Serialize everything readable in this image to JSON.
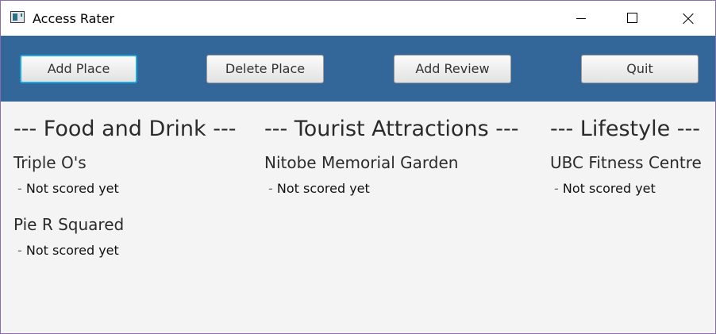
{
  "window": {
    "title": "Access Rater",
    "controls": {
      "minimize_icon": "minimize-icon",
      "maximize_icon": "maximize-icon",
      "close_icon": "close-icon"
    }
  },
  "toolbar": {
    "background": "#336699",
    "focus_color": "#1ea7e0",
    "buttons": [
      {
        "label": "Add Place",
        "focused": true
      },
      {
        "label": "Delete Place",
        "focused": false
      },
      {
        "label": "Add Review",
        "focused": false
      },
      {
        "label": "Quit",
        "focused": false
      }
    ]
  },
  "categories": [
    {
      "heading": "--- Food and Drink ---",
      "places": [
        {
          "name": "Triple O's",
          "score_prefix": "- ",
          "score": "Not scored yet"
        },
        {
          "name": "Pie R Squared",
          "score_prefix": "- ",
          "score": "Not scored yet"
        }
      ]
    },
    {
      "heading": "--- Tourist Attractions ---",
      "places": [
        {
          "name": "Nitobe Memorial Garden",
          "score_prefix": "- ",
          "score": "Not scored yet"
        }
      ]
    },
    {
      "heading": "--- Lifestyle ---",
      "places": [
        {
          "name": "UBC Fitness Centre",
          "score_prefix": "- ",
          "score": "Not scored yet"
        }
      ]
    }
  ]
}
